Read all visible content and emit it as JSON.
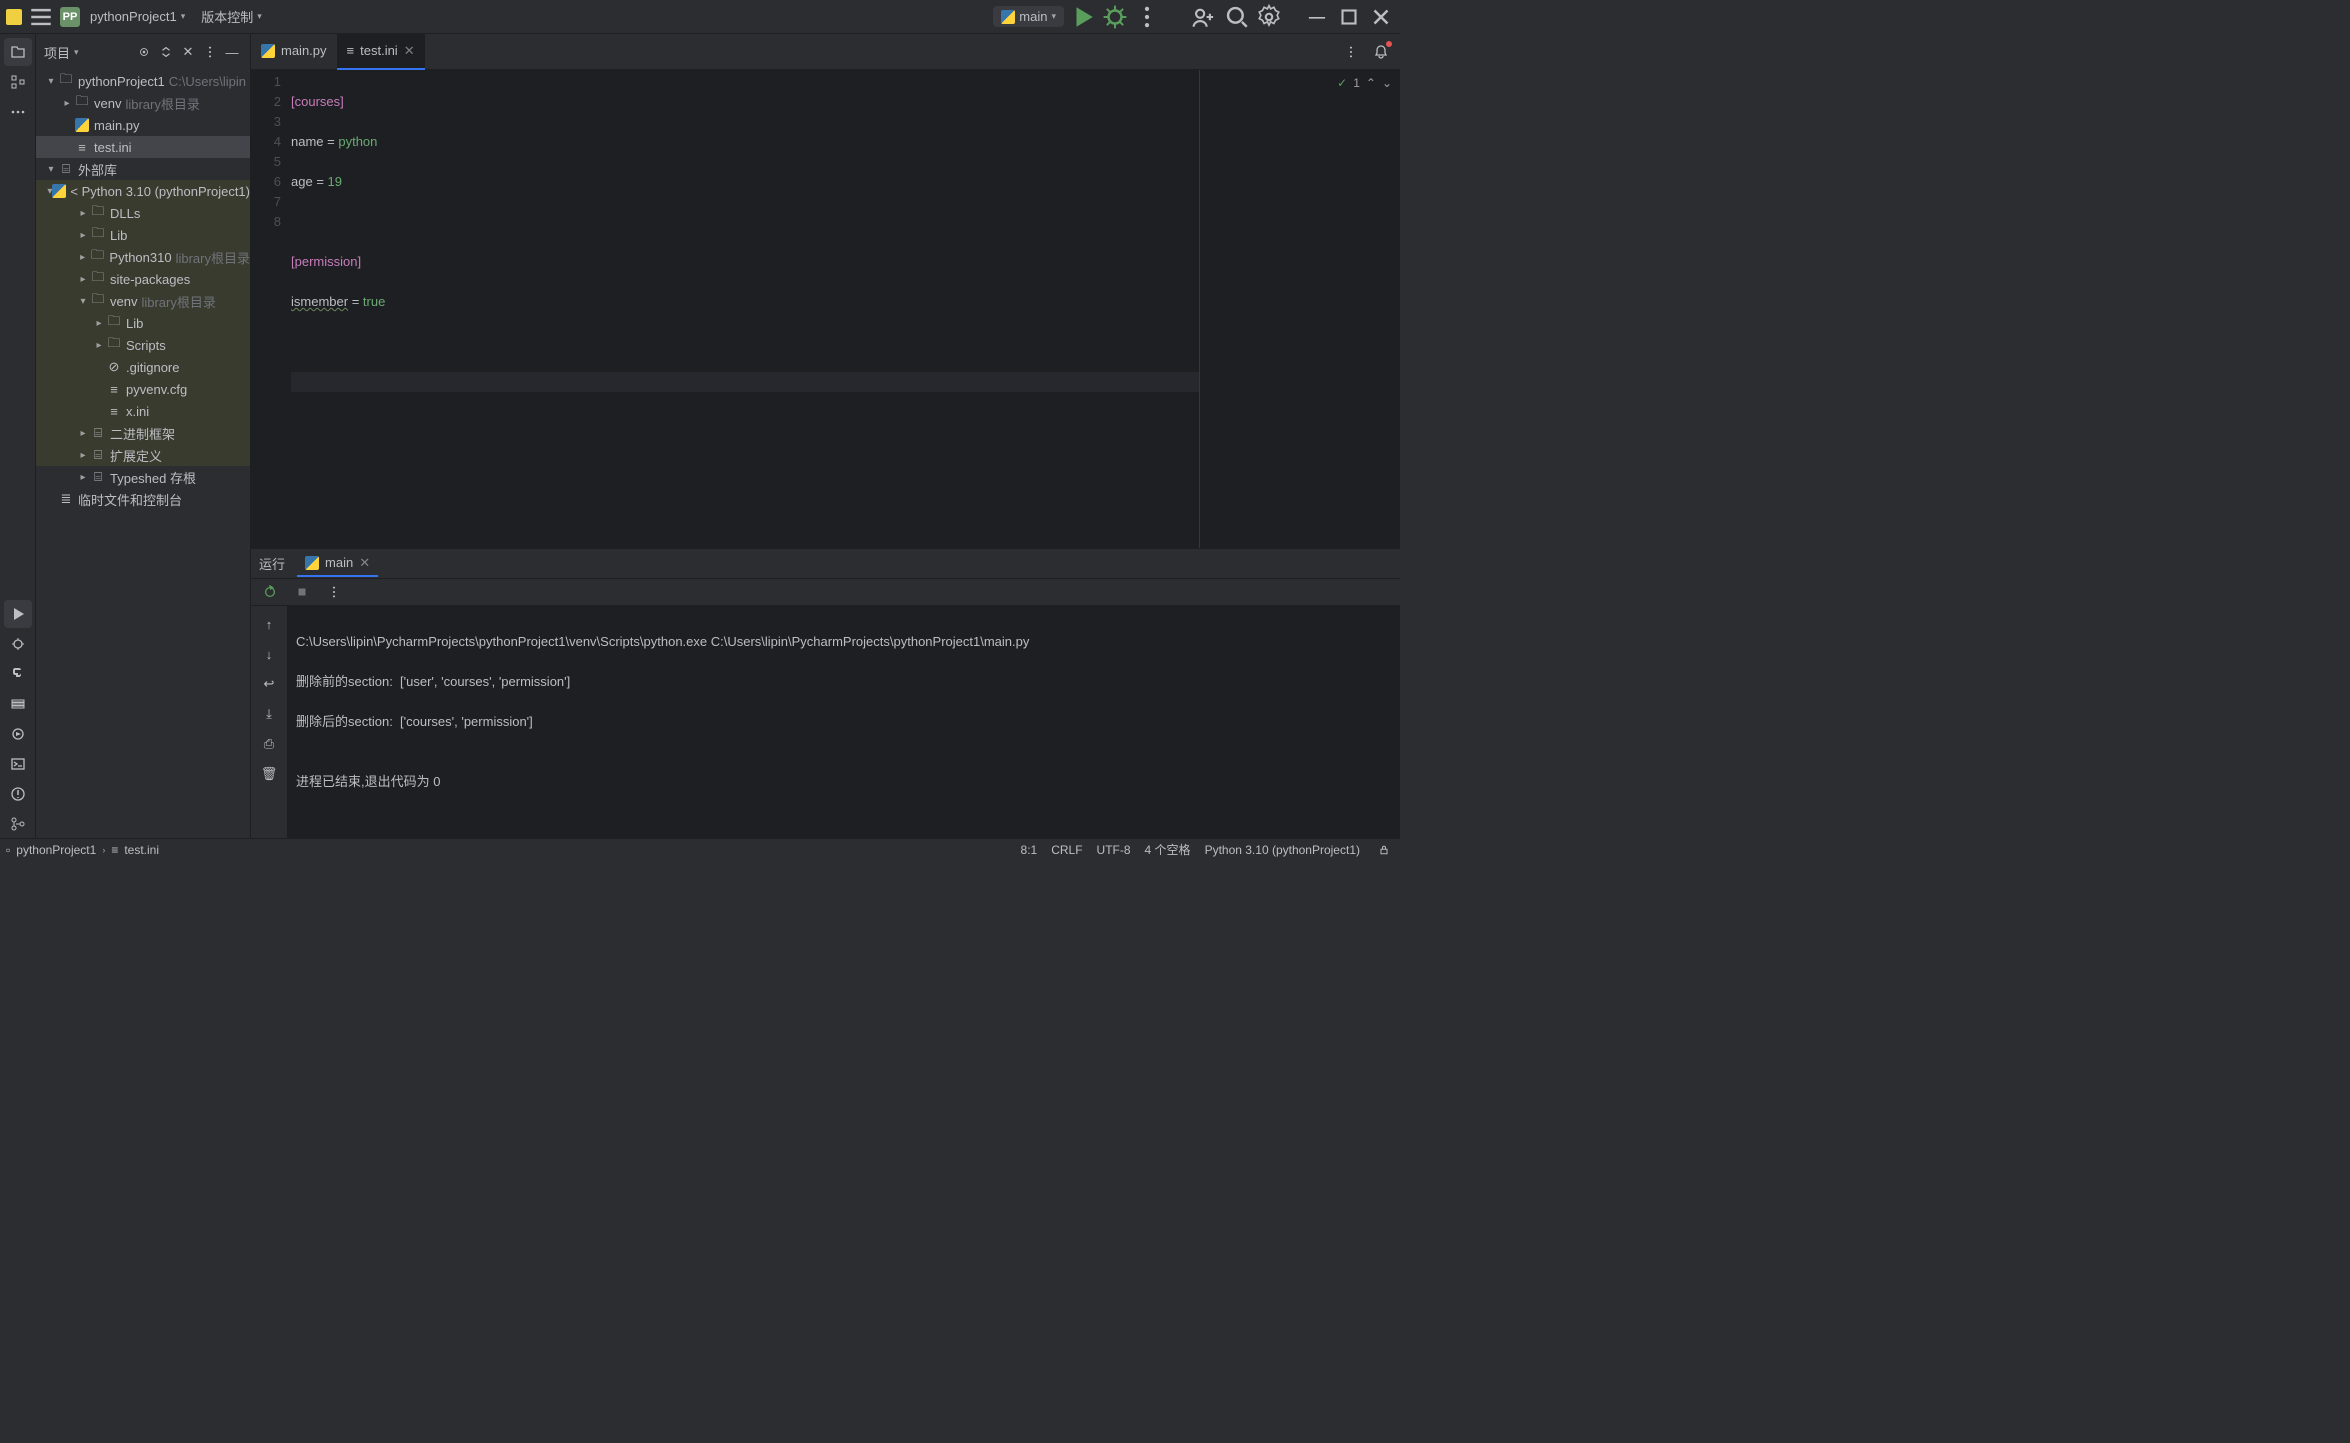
{
  "titlebar": {
    "project": "pythonProject1",
    "vc_menu": "版本控制",
    "run_config": "main"
  },
  "project_panel": {
    "title": "项目",
    "tree": {
      "root": "pythonProject1",
      "root_path": "C:\\Users\\lipin",
      "venv": "venv",
      "venv_hint": "library根目录",
      "main_py": "main.py",
      "test_ini": "test.ini",
      "ext_lib": "外部库",
      "python310": "< Python 3.10 (pythonProject1)",
      "dlls": "DLLs",
      "lib": "Lib",
      "python310dir": "Python310",
      "python310_hint": "library根目录",
      "site_packages": "site-packages",
      "venv2": "venv",
      "venv2_hint": "library根目录",
      "venv_lib": "Lib",
      "venv_scripts": "Scripts",
      "gitignore": ".gitignore",
      "pyvenv": "pyvenv.cfg",
      "xini": "x.ini",
      "binframes": "二进制框架",
      "extdefs": "扩展定义",
      "typeshed": "Typeshed 存根",
      "scratch": "临时文件和控制台"
    }
  },
  "tabs": {
    "main_py": "main.py",
    "test_ini": "test.ini"
  },
  "editor": {
    "lines": [
      "1",
      "2",
      "3",
      "4",
      "5",
      "6",
      "7",
      "8"
    ],
    "l1_sect": "[courses]",
    "l2_key": "name",
    "l2_val": "python",
    "l3_key": "age",
    "l3_val": "19",
    "l5_sect": "[permission]",
    "l6_key": "ismember",
    "l6_val": "true",
    "inspect_count": "1"
  },
  "run": {
    "title": "运行",
    "tab": "main",
    "out1": "C:\\Users\\lipin\\PycharmProjects\\pythonProject1\\venv\\Scripts\\python.exe C:\\Users\\lipin\\PycharmProjects\\pythonProject1\\main.py",
    "out2": "删除前的section:  ['user', 'courses', 'permission']",
    "out3": "删除后的section:  ['courses', 'permission']",
    "out4": "",
    "out5": "进程已结束,退出代码为 0"
  },
  "status": {
    "crumb1": "pythonProject1",
    "crumb2": "test.ini",
    "pos": "8:1",
    "le": "CRLF",
    "enc": "UTF-8",
    "indent": "4 个空格",
    "interp": "Python 3.10 (pythonProject1)"
  }
}
